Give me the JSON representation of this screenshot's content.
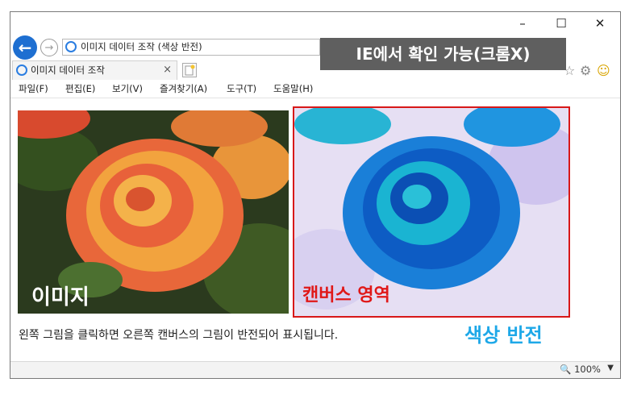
{
  "window": {
    "minimize_glyph": "–",
    "maximize_glyph": "☐",
    "close_glyph": "✕"
  },
  "address_bar": {
    "url_text": "이미지 데이터 조작 (색상 반전)"
  },
  "annotation_top": "IE에서 확인 가능(크롬X)",
  "tab": {
    "label": "이미지 데이터 조작",
    "close_glyph": "×"
  },
  "menu": [
    "파일(F)",
    "편집(E)",
    "보기(V)",
    "즐겨찾기(A)",
    "도구(T)",
    "도움말(H)"
  ],
  "content": {
    "image_label": "이미지",
    "canvas_label": "캔버스 영역",
    "description": "왼쪽 그림을 클릭하면 오른쪽 캔버스의 그림이 반전되어 표시됩니다.",
    "invert_label": "색상 반전"
  },
  "status": {
    "zoom": "100%"
  },
  "colors": {
    "accent_blue": "#1e6fd1",
    "canvas_border": "#d81818",
    "invert_label": "#1ea8e8"
  }
}
